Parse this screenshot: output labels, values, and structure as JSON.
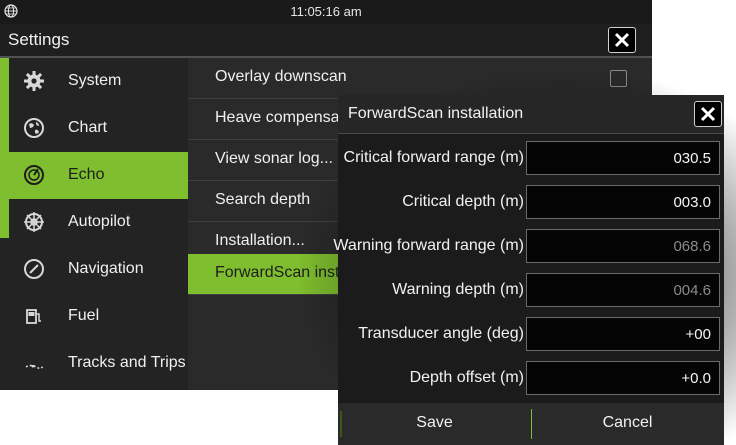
{
  "status_bar": {
    "time": "11:05:16 am",
    "globe_icon": "globe-icon"
  },
  "header": {
    "title": "Settings",
    "close_icon": "close-icon"
  },
  "sidebar": {
    "accent_color": "#7fbe2e",
    "items": [
      {
        "label": "System",
        "icon": "gear-icon",
        "active": false
      },
      {
        "label": "Chart",
        "icon": "globe-chart-icon",
        "active": false
      },
      {
        "label": "Echo",
        "icon": "echo-icon",
        "active": true
      },
      {
        "label": "Autopilot",
        "icon": "helm-icon",
        "active": false
      },
      {
        "label": "Navigation",
        "icon": "compass-icon",
        "active": false
      },
      {
        "label": "Fuel",
        "icon": "fuel-icon",
        "active": false
      },
      {
        "label": "Tracks and Trips",
        "icon": "tracks-icon",
        "active": false
      }
    ]
  },
  "echo_menu": {
    "items": [
      {
        "label": "Overlay downscan",
        "has_checkbox": true,
        "checked": false
      },
      {
        "label": "Heave compensation"
      },
      {
        "label": "View sonar log..."
      },
      {
        "label": "Search depth"
      },
      {
        "label": "Installation..."
      },
      {
        "label": "ForwardScan installation",
        "active": true
      }
    ]
  },
  "dialog": {
    "title": "ForwardScan installation",
    "close_icon": "close-icon",
    "fields": [
      {
        "label": "Critical forward range (m)",
        "value": "030.5",
        "enabled": true
      },
      {
        "label": "Critical depth (m)",
        "value": "003.0",
        "enabled": true
      },
      {
        "label": "Warning forward range (m)",
        "value": "068.6",
        "enabled": false
      },
      {
        "label": "Warning depth (m)",
        "value": "004.6",
        "enabled": false
      },
      {
        "label": "Transducer angle (deg)",
        "value": "+00",
        "enabled": true
      },
      {
        "label": "Depth offset (m)",
        "value": "+0.0",
        "enabled": true
      }
    ],
    "buttons": {
      "save": "Save",
      "cancel": "Cancel"
    }
  }
}
